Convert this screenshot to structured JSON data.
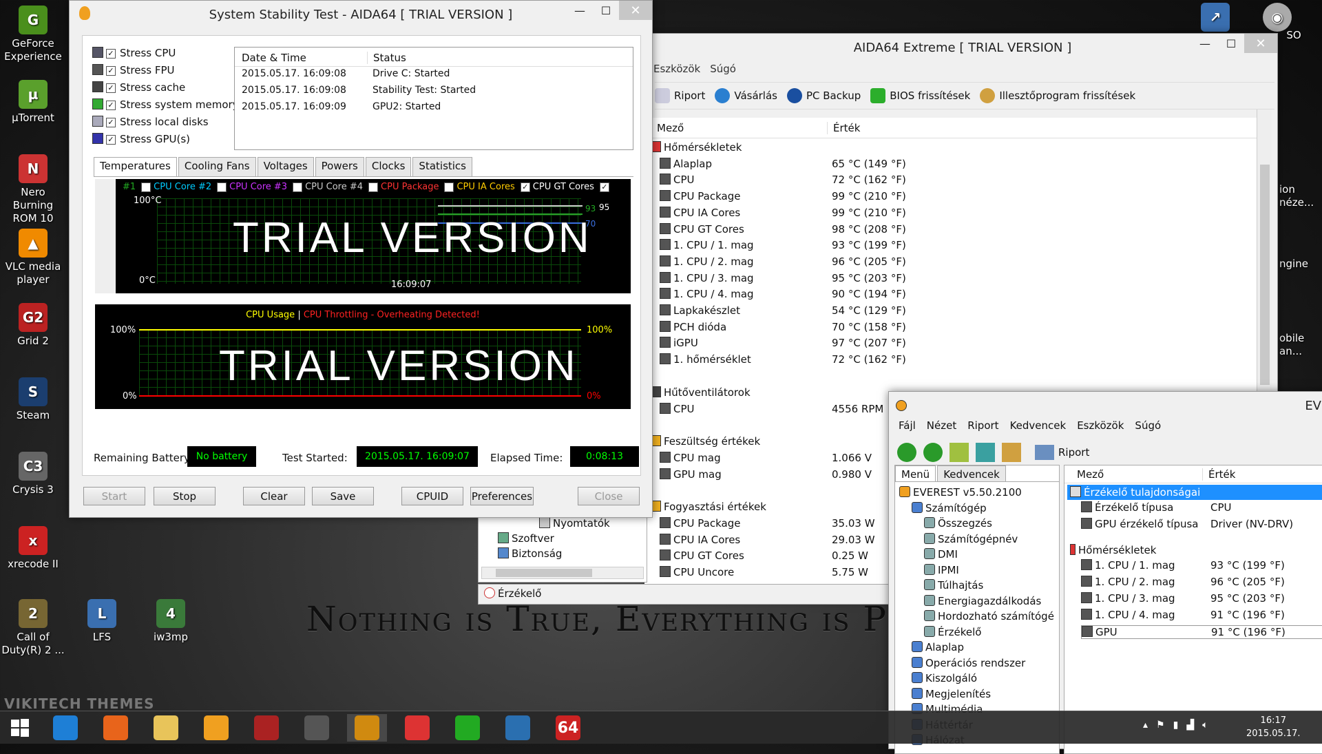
{
  "desktop": {
    "icons": [
      {
        "label": "GeForce Experience",
        "color": "#4a8f1c",
        "glyph": "G"
      },
      {
        "label": "µTorrent",
        "color": "#5aa02c",
        "glyph": "µ"
      },
      {
        "label": "Nero Burning ROM 10",
        "color": "#c33",
        "glyph": "N"
      },
      {
        "label": "VLC media player",
        "color": "#f08a00",
        "glyph": "▲"
      },
      {
        "label": "Grid 2",
        "color": "#b22",
        "glyph": "G2"
      },
      {
        "label": "Steam",
        "color": "#1b3e6f",
        "glyph": "S"
      },
      {
        "label": "Crysis 3",
        "color": "#666",
        "glyph": "C3"
      },
      {
        "label": "xrecode II",
        "color": "#c22",
        "glyph": "x"
      },
      {
        "label": "Call of Duty(R) 2 ...",
        "color": "#776633",
        "glyph": "2"
      },
      {
        "label": "LFS",
        "color": "#3a6fb0",
        "glyph": "L"
      },
      {
        "label": "iw3mp",
        "color": "#3a7a3a",
        "glyph": "4"
      }
    ],
    "right_partial": [
      "ion",
      "néze...",
      "ngine",
      "obile",
      "an..."
    ],
    "top_right_label": "SO",
    "wallpaper_text": "Nothing is True, Everything is Per",
    "watermark": "VIKITECH THEMES"
  },
  "stability": {
    "title": "System Stability Test - AIDA64  [ TRIAL VERSION ]",
    "stress": [
      "Stress CPU",
      "Stress FPU",
      "Stress cache",
      "Stress system memory",
      "Stress local disks",
      "Stress GPU(s)"
    ],
    "log_headers": [
      "Date & Time",
      "Status"
    ],
    "log": [
      [
        "2015.05.17. 16:09:08",
        "Drive C: Started"
      ],
      [
        "2015.05.17. 16:09:08",
        "Stability Test: Started"
      ],
      [
        "2015.05.17. 16:09:09",
        "GPU2: Started"
      ]
    ],
    "tabs": [
      "Temperatures",
      "Cooling Fans",
      "Voltages",
      "Powers",
      "Clocks",
      "Statistics"
    ],
    "legend": [
      "#1",
      "CPU Core #2",
      "CPU Core #3",
      "CPU Core #4",
      "CPU Package",
      "CPU IA Cores",
      "CPU GT Cores"
    ],
    "graph1": {
      "ymax": "100°C",
      "ymin": "0°C",
      "time": "16:09:07",
      "v1": "93",
      "v2": "95",
      "v3": "70",
      "watermark": "TRIAL VERSION"
    },
    "graph2": {
      "title_a": "CPU Usage",
      "sep": "|",
      "title_b": "CPU Throttling - Overheating Detected!",
      "ymax_l": "100%",
      "ymin_l": "0%",
      "ymax_r": "100%",
      "ymin_r": "0%",
      "watermark": "TRIAL VERSION"
    },
    "battery_label": "Remaining Battery:",
    "battery_value": "No battery",
    "started_label": "Test Started:",
    "started_value": "2015.05.17. 16:09:07",
    "elapsed_label": "Elapsed Time:",
    "elapsed_value": "0:08:13",
    "buttons": [
      "Start",
      "Stop",
      "Clear",
      "Save",
      "CPUID",
      "Preferences",
      "Close"
    ]
  },
  "extreme": {
    "title": "AIDA64 Extreme  [ TRIAL VERSION ]",
    "menu": [
      "Eszközök",
      "Súgó"
    ],
    "toolbar": [
      "Riport",
      "Vásárlás",
      "PC Backup",
      "BIOS frissítések",
      "Illesztőprogram frissítések"
    ],
    "col_field": "Mező",
    "col_value": "Érték",
    "sections": [
      {
        "title": "Hőmérsékletek",
        "rows": [
          [
            "Alaplap",
            "65 °C  (149 °F)"
          ],
          [
            "CPU",
            "72 °C  (162 °F)"
          ],
          [
            "CPU Package",
            "99 °C  (210 °F)"
          ],
          [
            "CPU IA Cores",
            "99 °C  (210 °F)"
          ],
          [
            "CPU GT Cores",
            "98 °C  (208 °F)"
          ],
          [
            "1. CPU / 1. mag",
            "93 °C  (199 °F)"
          ],
          [
            "1. CPU / 2. mag",
            "96 °C  (205 °F)"
          ],
          [
            "1. CPU / 3. mag",
            "95 °C  (203 °F)"
          ],
          [
            "1. CPU / 4. mag",
            "90 °C  (194 °F)"
          ],
          [
            "Lapkakészlet",
            "54 °C  (129 °F)"
          ],
          [
            "PCH dióda",
            "70 °C  (158 °F)"
          ],
          [
            "iGPU",
            "97 °C  (207 °F)"
          ],
          [
            "1. hőmérséklet",
            "72 °C  (162 °F)"
          ]
        ]
      },
      {
        "title": "Hűtőventilátorok",
        "rows": [
          [
            "CPU",
            "4556 RPM"
          ]
        ]
      },
      {
        "title": "Feszültség értékek",
        "rows": [
          [
            "CPU mag",
            "1.066 V"
          ],
          [
            "GPU mag",
            "0.980 V"
          ]
        ]
      },
      {
        "title": "Fogyasztási értékek",
        "rows": [
          [
            "CPU Package",
            "35.03 W"
          ],
          [
            "CPU IA Cores",
            "29.03 W"
          ],
          [
            "CPU GT Cores",
            "0.25 W"
          ],
          [
            "CPU Uncore",
            "5.75 W"
          ]
        ]
      }
    ],
    "tree_partial": [
      "Nyomtatók",
      "Szoftver",
      "Biztonság"
    ],
    "status_item": "Érzékelő"
  },
  "everest": {
    "title": "EV",
    "menu": [
      "Fájl",
      "Nézet",
      "Riport",
      "Kedvencek",
      "Eszközök",
      "Súgó"
    ],
    "toolbar_report": "Riport",
    "tabs": [
      "Menü",
      "Kedvencek"
    ],
    "tree": [
      {
        "label": "EVEREST v5.50.2100",
        "level": 0
      },
      {
        "label": "Számítógép",
        "level": 1
      },
      {
        "label": "Összegzés",
        "level": 2
      },
      {
        "label": "Számítógépnév",
        "level": 2
      },
      {
        "label": "DMI",
        "level": 2
      },
      {
        "label": "IPMI",
        "level": 2
      },
      {
        "label": "Túlhajtás",
        "level": 2
      },
      {
        "label": "Energiagazdálkodás",
        "level": 2
      },
      {
        "label": "Hordozható számítógé",
        "level": 2
      },
      {
        "label": "Érzékelő",
        "level": 2
      },
      {
        "label": "Alaplap",
        "level": 1
      },
      {
        "label": "Operációs rendszer",
        "level": 1
      },
      {
        "label": "Kiszolgáló",
        "level": 1
      },
      {
        "label": "Megjelenítés",
        "level": 1
      },
      {
        "label": "Multimédia",
        "level": 1
      },
      {
        "label": "Háttértár",
        "level": 1
      },
      {
        "label": "Hálózat",
        "level": 1
      }
    ],
    "col_field": "Mező",
    "col_value": "Érték",
    "props_title": "Érzékelő tulajdonságai",
    "props": [
      [
        "Érzékelő típusa",
        "CPU"
      ],
      [
        "GPU érzékelő típusa",
        "Driver  (NV-DRV)"
      ]
    ],
    "temps_title": "Hőmérsékletek",
    "temps": [
      [
        "1. CPU / 1. mag",
        "93 °C  (199 °F)"
      ],
      [
        "1. CPU / 2. mag",
        "96 °C  (205 °F)"
      ],
      [
        "1. CPU / 3. mag",
        "95 °C  (203 °F)"
      ],
      [
        "1. CPU / 4. mag",
        "91 °C  (196 °F)"
      ],
      [
        "GPU",
        "91 °C  (196 °F)"
      ]
    ]
  },
  "taskbar": {
    "apps": [
      {
        "name": "internet-explorer",
        "color": "#1e7fd6"
      },
      {
        "name": "firefox",
        "color": "#e8641b"
      },
      {
        "name": "file-explorer",
        "color": "#e8c45a"
      },
      {
        "name": "media-player",
        "color": "#f0a020"
      },
      {
        "name": "grid-2",
        "color": "#a22"
      },
      {
        "name": "crysis",
        "color": "#555"
      },
      {
        "name": "aida64-info",
        "color": "#d08a10"
      },
      {
        "name": "speed-app",
        "color": "#d33"
      },
      {
        "name": "chart-app",
        "color": "#2a2"
      },
      {
        "name": "steam",
        "color": "#2a6fb0"
      },
      {
        "name": "aida64",
        "color": "#c22"
      }
    ],
    "app64": "64",
    "time": "16:17",
    "date": "2015.05.17."
  }
}
